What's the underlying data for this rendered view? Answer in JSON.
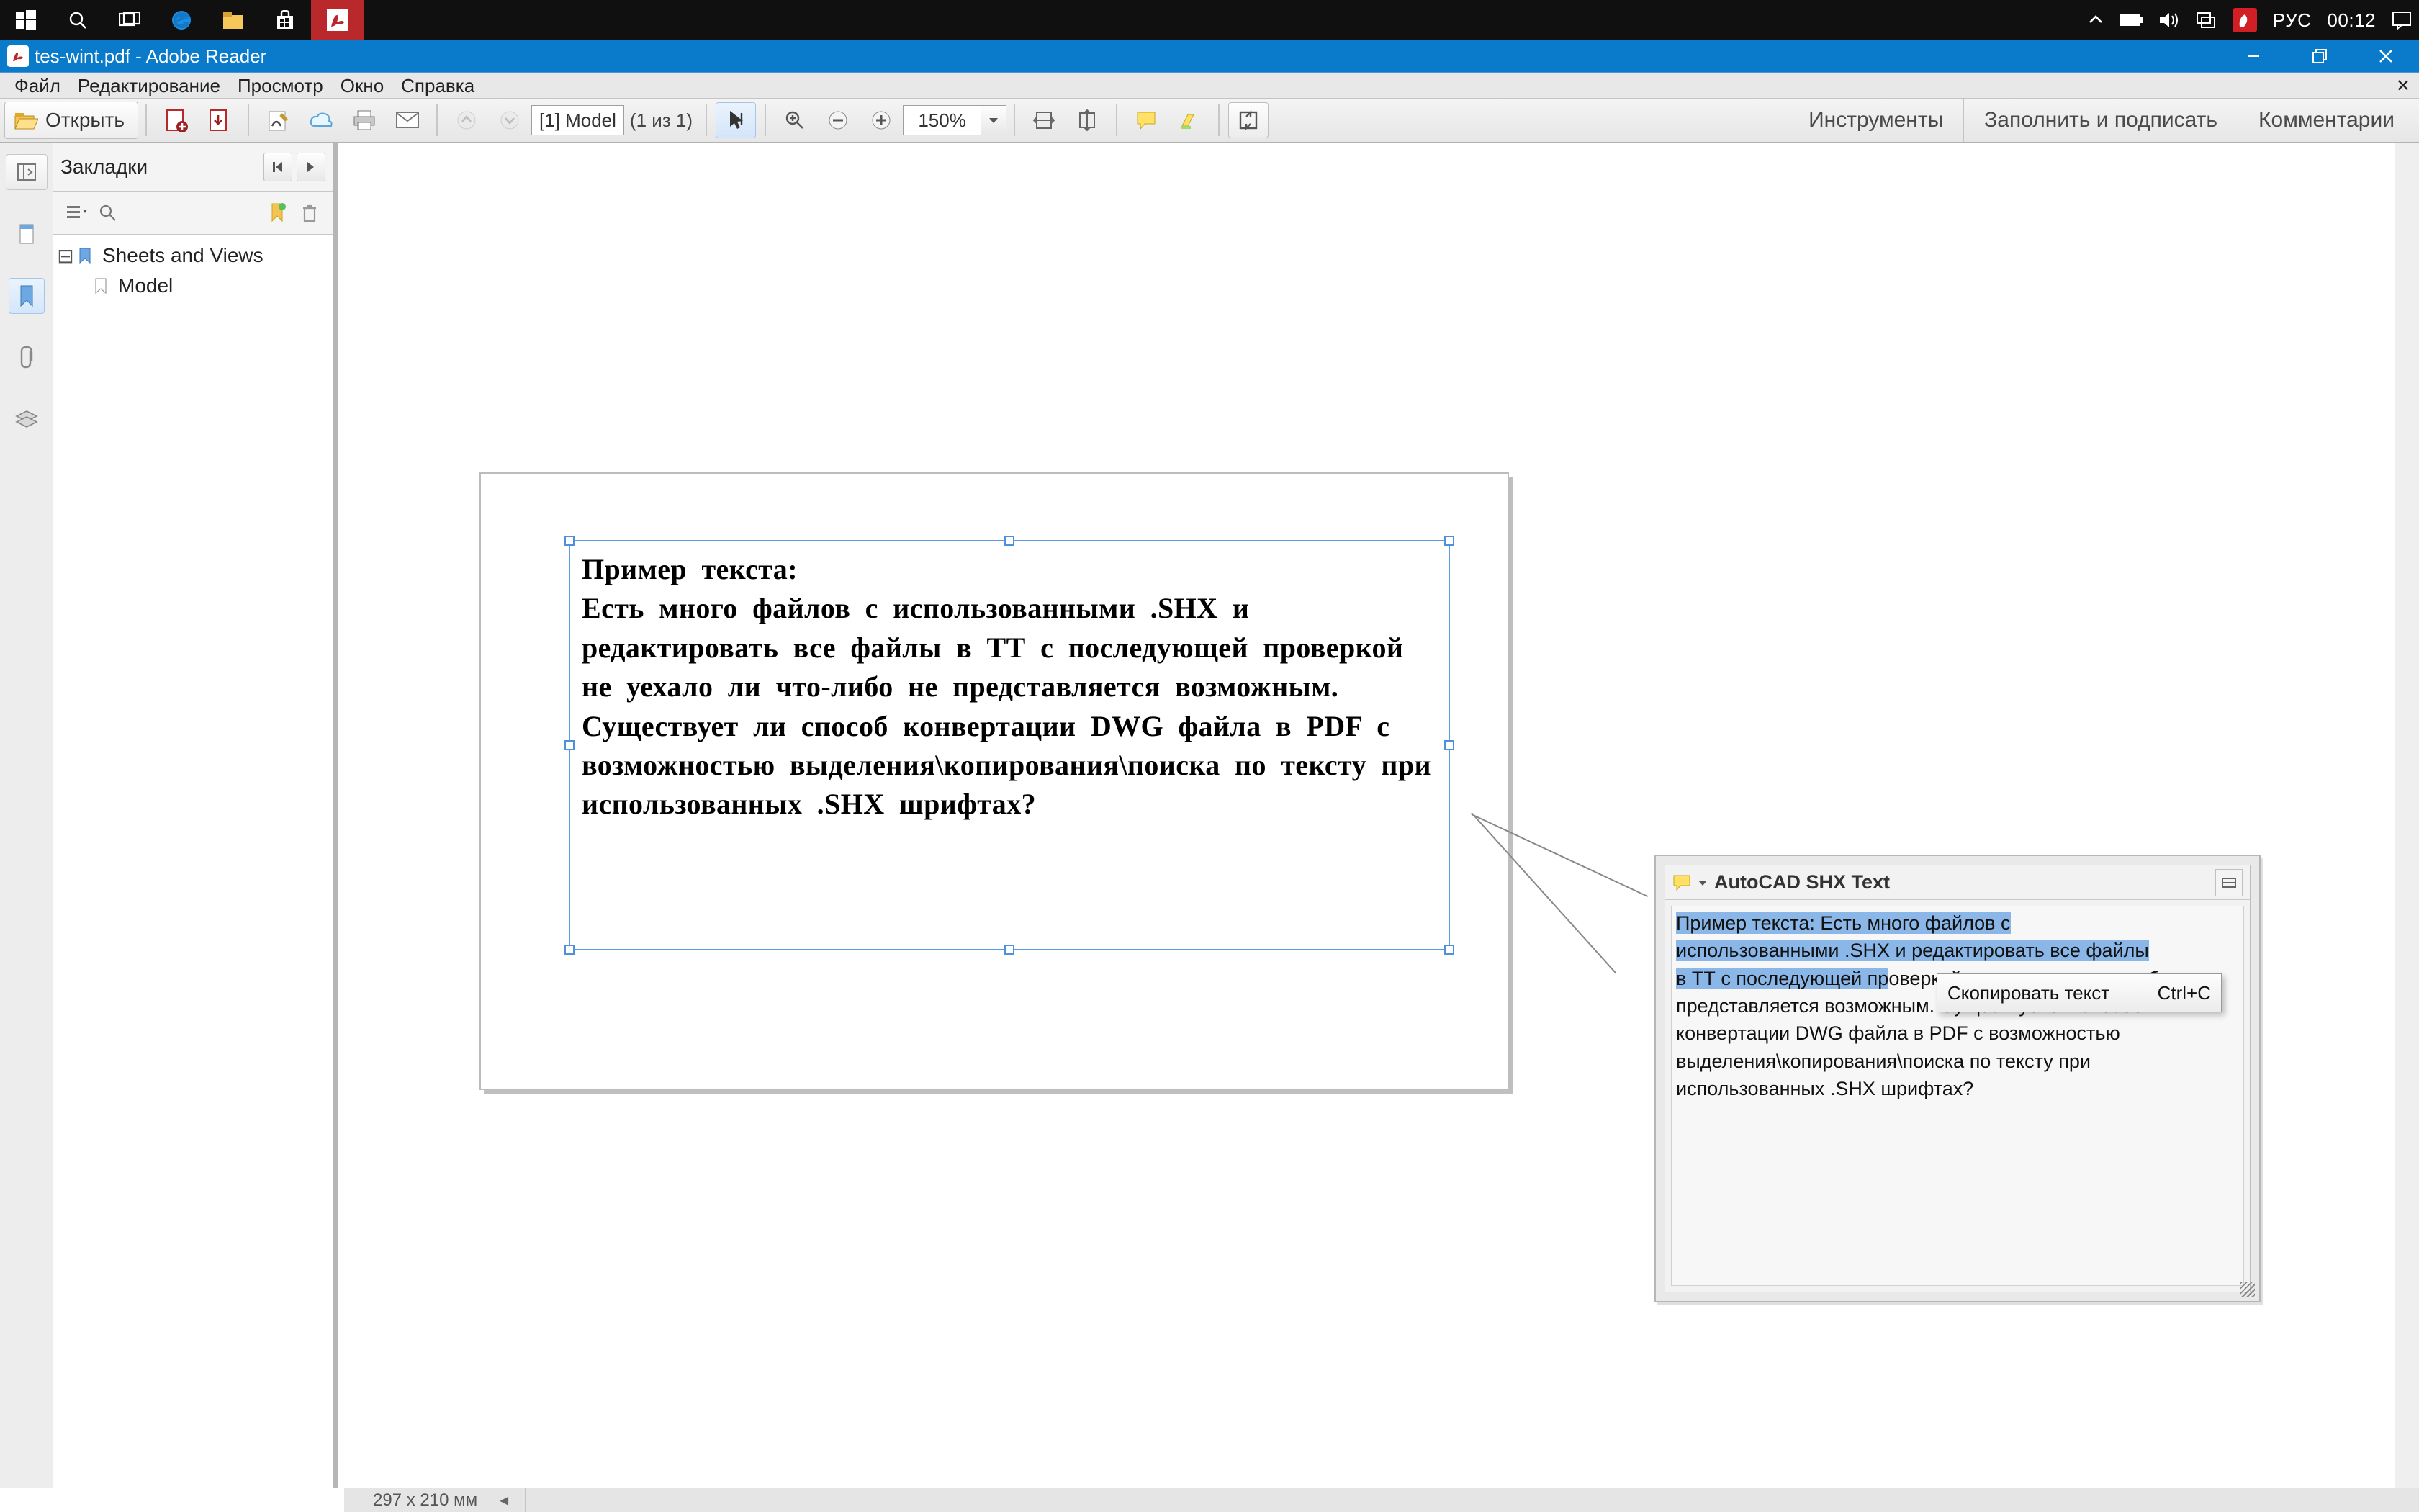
{
  "taskbar": {
    "lang": "РУС",
    "time": "00:12"
  },
  "titlebar": {
    "title": "tes-wint.pdf - Adobe Reader"
  },
  "menu": {
    "file": "Файл",
    "edit": "Редактирование",
    "view": "Просмотр",
    "window": "Окно",
    "help": "Справка"
  },
  "toolbar": {
    "open": "Открыть",
    "page_label": "[1] Model",
    "page_count": "(1 из 1)",
    "zoom": "150%"
  },
  "right_tabs": {
    "tools": "Инструменты",
    "fill_sign": "Заполнить и подписать",
    "comments": "Комментарии"
  },
  "bookmarks": {
    "title": "Закладки",
    "node1": "Sheets and Views",
    "node2": "Model"
  },
  "doc_text": "Пример текста:\nЕсть много файлов с использованными .SHX и редактировать все файлы в ТТ с последующей проверкой не уехало ли что-либо не представляется возможным. Существует ли способ конвертации DWG файла в PDF с возможностью выделения\\копирования\\поиска по тексту при использованных .SHX шрифтах?",
  "popup": {
    "title": "AutoCAD SHX Text",
    "line1_hl": "Пример текста: Есть много файлов с ",
    "line2a_hl": "использованными .SHX ",
    "line2b_hl": "и редактировать все файлы ",
    "line3a_hl": "в ТТ с последующей пр",
    "rest": "оверкой не уехало ли что-либо не представляется возможным. Существует ли способ конвертации DWG файла в PDF с возможностью выделения\\копирования\\поиска по тексту при использованных .SHX шрифтах?"
  },
  "context_menu": {
    "copy_label": "Скопировать текст",
    "copy_shortcut": "Ctrl+C"
  },
  "status": {
    "dims": "297 x 210 мм"
  }
}
